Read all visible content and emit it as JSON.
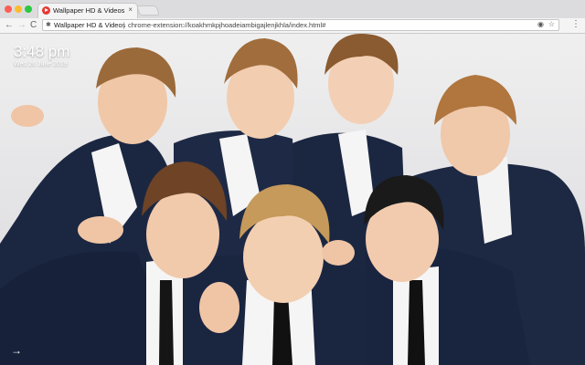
{
  "window": {
    "tab_title": "Wallpaper HD & Videos",
    "tab_close": "×"
  },
  "toolbar": {
    "back": "←",
    "forward": "→",
    "reload": "C",
    "origin": "Wallpaper HD & Videos",
    "url": "chrome-extension://koakhmkpjhoadeiambigajlenjkhla/index.html#",
    "menu": "⋮"
  },
  "wallpaper": {
    "time": "3:48 pm",
    "date": "Wed 26  June 2019",
    "next_arrow": "→"
  },
  "colors": {
    "suit": "#1b2741",
    "skin": "#f0c7a7",
    "shirt": "#f5f5f5"
  }
}
